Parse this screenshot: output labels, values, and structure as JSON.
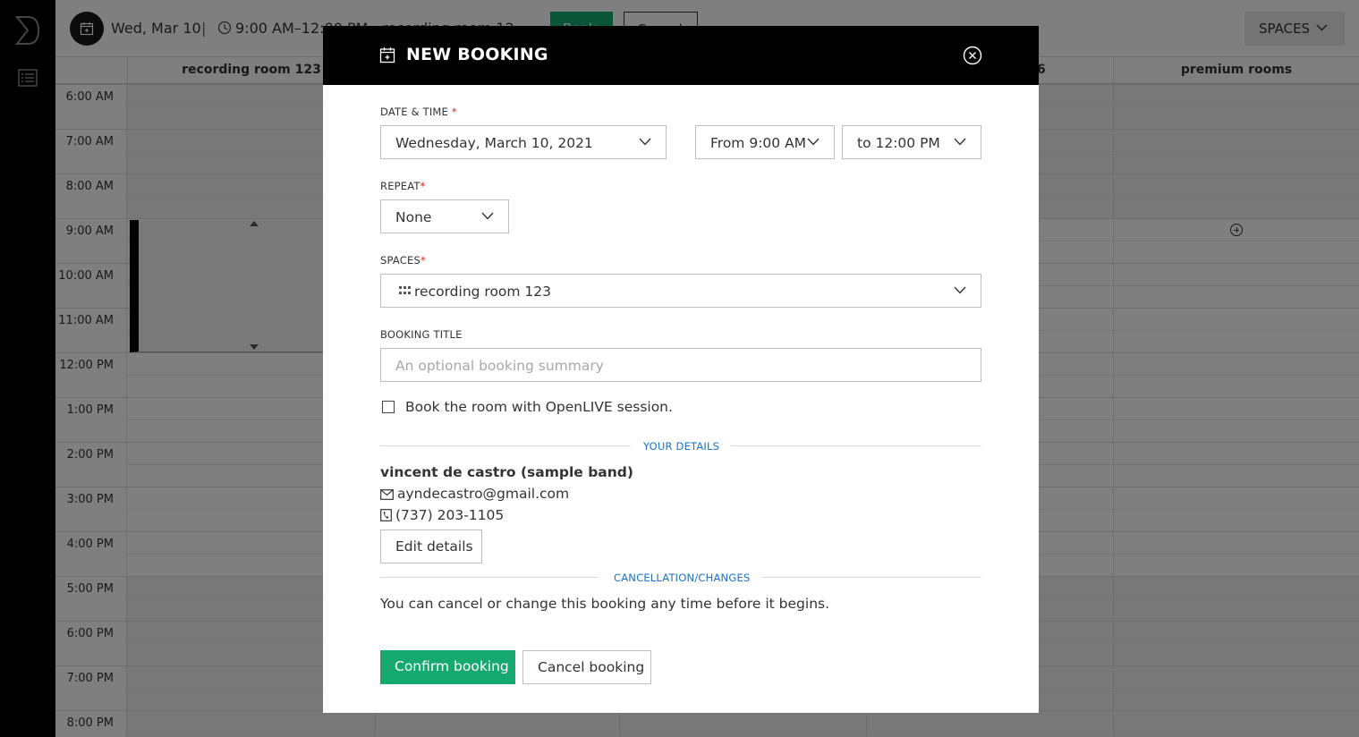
{
  "topbar": {
    "date": "Wed, Mar 10",
    "separator": "|",
    "time_range": "9:00 AM–12:00 PM",
    "space": "recording room 12",
    "book_label": "Book",
    "cancel_label": "Cancel",
    "spaces_button": "SPACES"
  },
  "calendar": {
    "columns": [
      "recording room 123",
      "",
      "",
      "6",
      "premium rooms"
    ],
    "hours": [
      "6:00 AM",
      "7:00 AM",
      "8:00 AM",
      "9:00 AM",
      "10:00 AM",
      "11:00 AM",
      "12:00 PM",
      "1:00 PM",
      "2:00 PM",
      "3:00 PM",
      "4:00 PM",
      "5:00 PM",
      "6:00 PM",
      "7:00 PM",
      "8:00 PM"
    ]
  },
  "modal": {
    "title": "NEW BOOKING",
    "date_time_label": "DATE & TIME",
    "required_mark": "*",
    "date_value": "Wednesday, March 10, 2021",
    "from_value": "From 9:00 AM",
    "to_value": "to 12:00 PM",
    "repeat_label": "REPEAT",
    "repeat_value": "None",
    "spaces_label": "SPACES",
    "spaces_value": "recording room 123",
    "booking_title_label": "BOOKING TITLE",
    "booking_title_placeholder": "An optional booking summary",
    "openlive_label": "Book the room with OpenLIVE session.",
    "your_details_heading": "YOUR DETAILS",
    "user_name": "vincent de castro (sample band)",
    "user_email": "ayndecastro@gmail.com",
    "user_phone": "(737) 203-1105",
    "edit_details_label": "Edit details",
    "cancellation_heading": "CANCELLATION/CHANGES",
    "cancellation_note": "You can cancel or change this booking any time before it begins.",
    "confirm_label": "Confirm booking",
    "cancel_booking_label": "Cancel booking"
  },
  "colors": {
    "accent_green": "#15a86f",
    "header_black": "#000000",
    "link_blue": "#1a73c8",
    "required_red": "#da1e28"
  },
  "icons": [
    "brand-logo-icon",
    "list-icon",
    "calendar-icon",
    "clock-icon",
    "grid-icon",
    "close-icon",
    "chevron-down-icon",
    "envelope-icon",
    "phone-icon",
    "add-circle-icon"
  ]
}
